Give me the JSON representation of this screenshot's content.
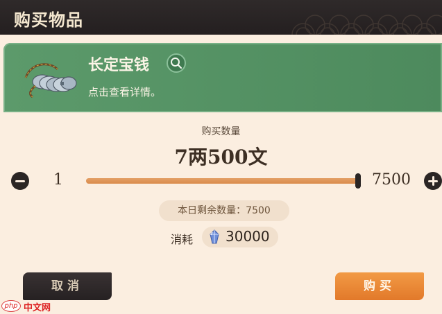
{
  "title": "购买物品",
  "item": {
    "name": "长定宝钱",
    "description": "点击查看详情。",
    "image_icon": "coin-string-icon",
    "detail_icon": "search-icon"
  },
  "quantity": {
    "label": "购买数量",
    "display": "7两500文",
    "min": "1",
    "max": "7500",
    "fill_fraction": 1.0
  },
  "remaining": {
    "text": "本日剩余数量：7500"
  },
  "cost": {
    "label": "消耗",
    "value": "30000",
    "currency_icon": "gem-icon"
  },
  "buttons": {
    "cancel": "取消",
    "buy": "购买"
  },
  "watermark": {
    "logo": "php",
    "text": "中文网"
  },
  "colors": {
    "accent_orange": "#e8873a",
    "card_green": "#5c9a6b",
    "dark": "#2a2524",
    "background": "#fbeee0"
  }
}
